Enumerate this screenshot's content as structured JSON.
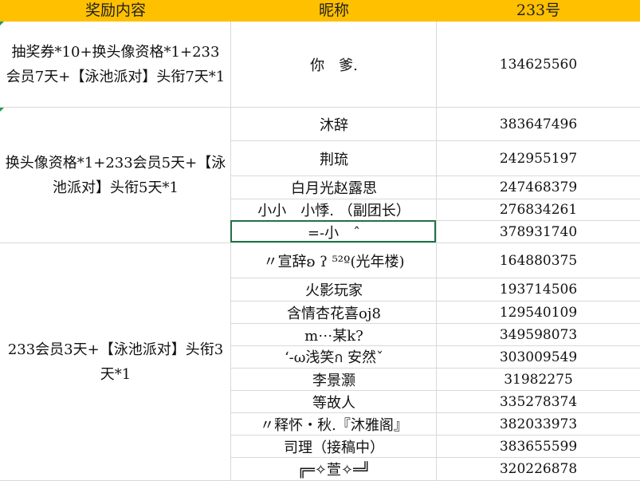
{
  "header": {
    "col_reward": "奖励内容",
    "col_nick": "昵称",
    "col_uid": "233号"
  },
  "groups": [
    {
      "reward": "抽奖券*10+换头像资格*1+233会员7天+【泳池派对】头衔7天*1"
    },
    {
      "reward": "换头像资格*1+233会员5天+【泳池派对】头衔5天*1"
    },
    {
      "reward": "233会员3天+【泳池派对】头衔3天*1"
    }
  ],
  "rows": [
    {
      "nick": "你　爹.",
      "uid": "134625560"
    },
    {
      "nick": "沐辞",
      "uid": "383647496"
    },
    {
      "nick": "荆琉",
      "uid": "242955197"
    },
    {
      "nick": "白月光赵露思",
      "uid": "247468379"
    },
    {
      "nick": "小小　小悸. （副团长）",
      "uid": "276834261"
    },
    {
      "nick": "=-小　ˆ",
      "uid": "378931740"
    },
    {
      "nick": "〃宣辞ʚ ʔ ⁵²º(光年楼)",
      "uid": "164880375"
    },
    {
      "nick": "火影玩家",
      "uid": "193714506"
    },
    {
      "nick": "含情杏花喜oj8",
      "uid": "129540109"
    },
    {
      "nick": "m⋯某k?",
      "uid": "349598073"
    },
    {
      "nick": "‘-ω浅笑ก 安然ˇ",
      "uid": "303009549"
    },
    {
      "nick": "李景灏",
      "uid": "31982275"
    },
    {
      "nick": "等故人",
      "uid": "335278374"
    },
    {
      "nick": "〃释怀・秋.『沐雅阁』",
      "uid": "382033973"
    },
    {
      "nick": "司理（接稿中）",
      "uid": "383655599"
    },
    {
      "nick": "╔═✧萱✧═╝",
      "uid": "320226878"
    }
  ]
}
